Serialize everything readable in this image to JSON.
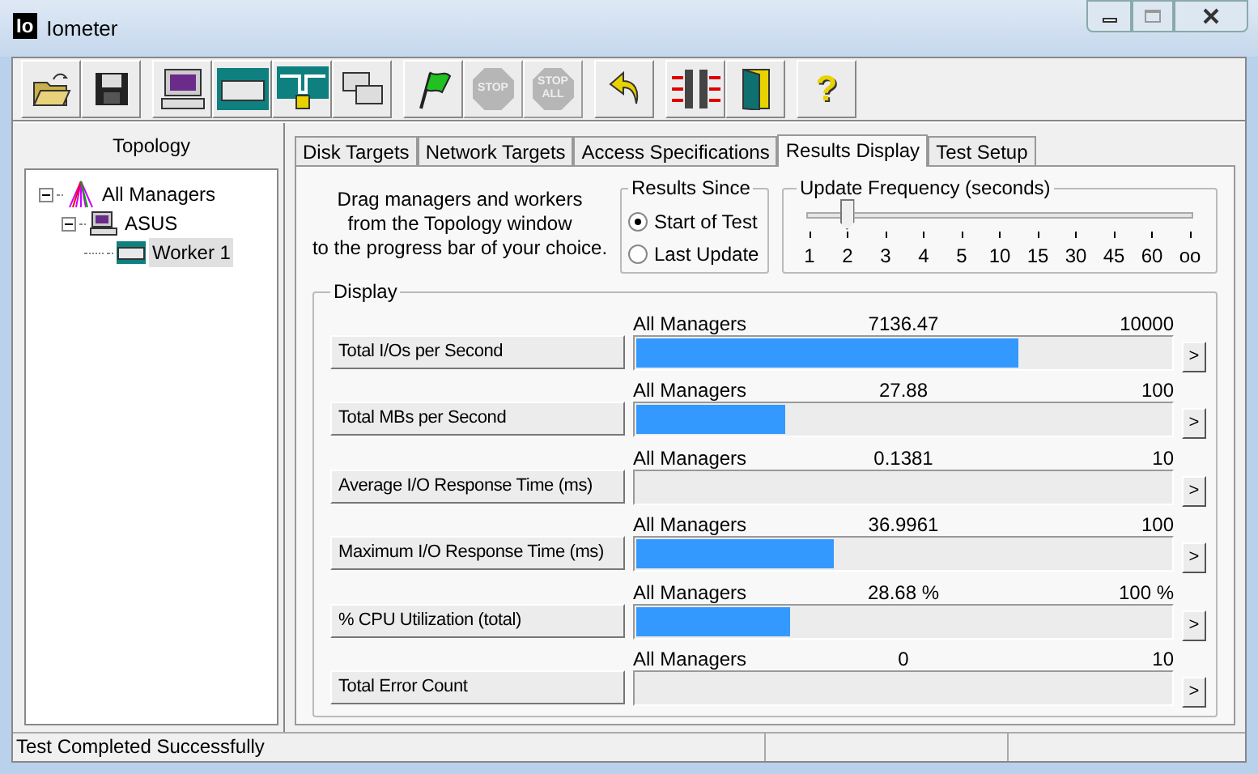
{
  "window": {
    "logo": "Io",
    "title": "Iometer"
  },
  "toolbar": [
    [
      {
        "kind": "open",
        "disabled": false
      },
      {
        "kind": "save",
        "disabled": false
      }
    ],
    [
      {
        "kind": "computer",
        "disabled": false
      },
      {
        "kind": "disk",
        "disabled": false
      },
      {
        "kind": "network",
        "disabled": false
      },
      {
        "kind": "copy",
        "disabled": false
      }
    ],
    [
      {
        "kind": "flag",
        "disabled": false
      },
      {
        "kind": "stop",
        "disabled": true,
        "label": "STOP"
      },
      {
        "kind": "stopall",
        "disabled": true,
        "label": "STOP",
        "sublabel": "ALL"
      }
    ],
    [
      {
        "kind": "reset",
        "disabled": false
      }
    ],
    [
      {
        "kind": "split",
        "disabled": false
      },
      {
        "kind": "exit",
        "disabled": false
      }
    ],
    [
      {
        "kind": "help",
        "disabled": false,
        "label": "?"
      }
    ]
  ],
  "topology": {
    "title": "Topology",
    "tree": [
      {
        "label": "All Managers",
        "kind": "managers",
        "expanded": true,
        "selected": false,
        "children": [
          {
            "label": "ASUS",
            "kind": "computer",
            "expanded": true,
            "selected": false,
            "children": [
              {
                "label": "Worker 1",
                "kind": "worker",
                "selected": true
              }
            ]
          }
        ]
      }
    ]
  },
  "tabs": [
    {
      "label": "Disk Targets",
      "selected": false
    },
    {
      "label": "Network Targets",
      "selected": false
    },
    {
      "label": "Access Specifications",
      "selected": false
    },
    {
      "label": "Results Display",
      "selected": true
    },
    {
      "label": "Test Setup",
      "selected": false
    }
  ],
  "instructions": [
    "Drag managers and workers",
    "from the Topology window",
    "to the progress bar of your choice."
  ],
  "results_since": {
    "title": "Results Since",
    "options": [
      {
        "label": "Start of Test",
        "selected": true
      },
      {
        "label": "Last Update",
        "selected": false
      }
    ]
  },
  "update_frequency": {
    "title": "Update Frequency (seconds)",
    "level": 0.1,
    "ticks": [
      "1",
      "2",
      "3",
      "4",
      "5",
      "10",
      "15",
      "30",
      "45",
      "60",
      "oo"
    ]
  },
  "display": {
    "title": "Display",
    "rows": [
      {
        "metric": "Total I/Os per Second",
        "source": "All Managers",
        "value": "7136.47",
        "max": "10000",
        "level": 0.714
      },
      {
        "metric": "Total MBs per Second",
        "source": "All Managers",
        "value": "27.88",
        "max": "100",
        "level": 0.279
      },
      {
        "metric": "Average I/O Response Time (ms)",
        "source": "All Managers",
        "value": "0.1381",
        "max": "10"
      },
      {
        "metric": "Maximum I/O Response Time (ms)",
        "source": "All Managers",
        "value": "36.9961",
        "max": "100",
        "level": 0.37
      },
      {
        "metric": "% CPU Utilization (total)",
        "source": "All Managers",
        "value": "28.68 %",
        "max": "100 %",
        "level": 0.287
      },
      {
        "metric": "Total Error Count",
        "source": "All Managers",
        "value": "0",
        "max": "10"
      }
    ],
    "more_label": ">"
  },
  "status_bar": {
    "message": "Test Completed Successfully"
  }
}
